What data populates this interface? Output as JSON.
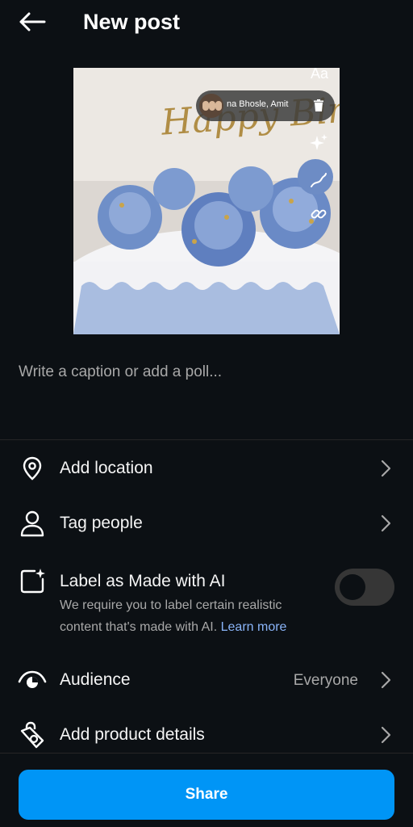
{
  "header": {
    "title": "New post",
    "back_icon": "arrow-left-icon"
  },
  "preview": {
    "music": {
      "artist": "na Bhosle, Amit",
      "delete_icon": "trash-icon"
    },
    "topper_text": "Happy Birthday",
    "tools": {
      "text_label": "Aa",
      "icons": [
        "text-icon",
        "sparkle-icon",
        "draw-icon",
        "link-icon"
      ]
    }
  },
  "caption": {
    "placeholder": "Write a caption or add a poll..."
  },
  "options": {
    "location": {
      "label": "Add location",
      "icon": "location-pin-icon"
    },
    "tag": {
      "label": "Tag people",
      "icon": "person-icon"
    },
    "ai_label": {
      "label": "Label as Made with AI",
      "description": "We require you to label certain realistic content that's made with AI.",
      "learn_more": "Learn more",
      "enabled": false,
      "icon": "ai-label-icon"
    },
    "audience": {
      "label": "Audience",
      "value": "Everyone",
      "icon": "eye-icon"
    },
    "product": {
      "label": "Add product details",
      "icon": "shopping-tag-icon"
    }
  },
  "share": {
    "label": "Share"
  },
  "colors": {
    "background": "#0c1014",
    "accent": "#0095f6",
    "link": "#8ab4f8",
    "secondary_text": "#a8a8a8"
  }
}
